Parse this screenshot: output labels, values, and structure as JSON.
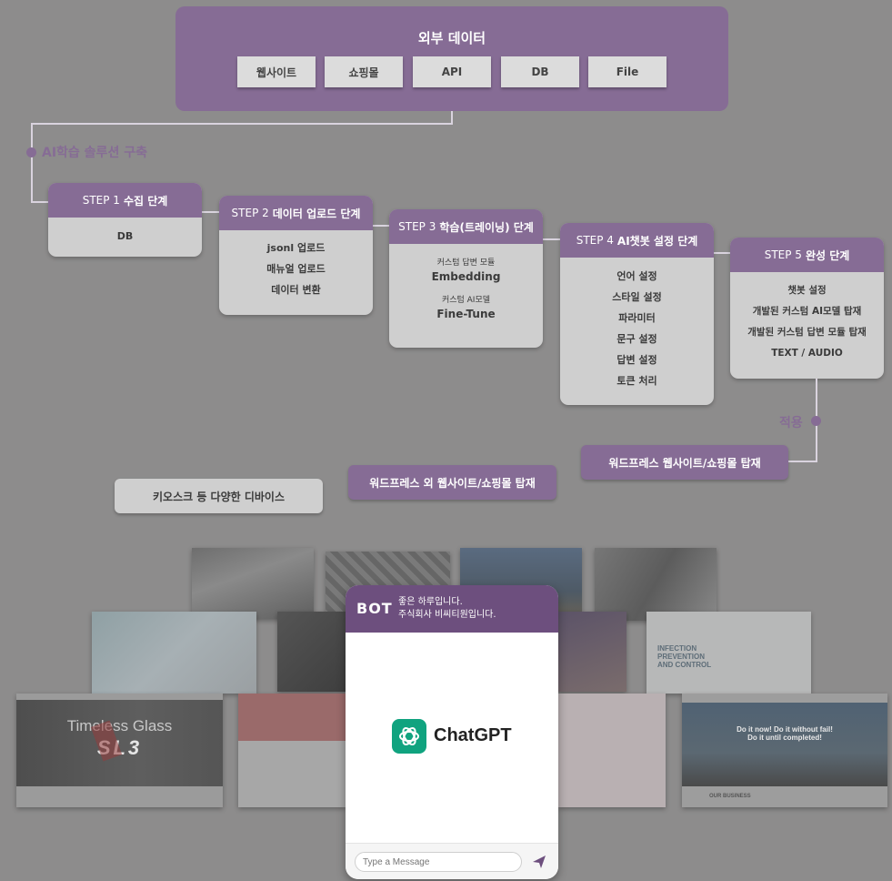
{
  "external": {
    "title": "외부 데이터",
    "sources": [
      "웹사이트",
      "쇼핑몰",
      "API",
      "DB",
      "File"
    ]
  },
  "ai_label": "AI학습 솔루션 구축",
  "apply_label": "적용",
  "steps": [
    {
      "num": "STEP 1",
      "title": "수집 단계",
      "items": [
        "DB"
      ]
    },
    {
      "num": "STEP 2",
      "title": "데이터 업로드 단계",
      "items": [
        "jsonl 업로드",
        "매뉴얼 업로드",
        "데이터 변환"
      ]
    },
    {
      "num": "STEP 3",
      "title": "학습(트레이닝) 단계",
      "items": [
        {
          "sub": "커스텀 답변 모듈",
          "main": "Embedding"
        },
        {
          "sub": "커스텀 AI모델",
          "main": "Fine-Tune"
        }
      ]
    },
    {
      "num": "STEP 4",
      "title": "AI챗봇 설정 단계",
      "items": [
        "언어 설정",
        "스타일 설정",
        "파라미터",
        "문구 설정",
        "답변 설정",
        "토큰 처리"
      ]
    },
    {
      "num": "STEP 5",
      "title": "완성 단계",
      "items": [
        "챗봇 설정",
        "개발된 커스텀 AI모델 탑재",
        "개발된 커스텀 답변 모듈 탑재",
        "TEXT / AUDIO"
      ]
    }
  ],
  "deploy": [
    "워드프레스 웹사이트/쇼핑몰 탑재",
    "워드프레스 외 웹사이트/쇼핑몰 탑재",
    "키오스크 등 다양한 디바이스"
  ],
  "chat": {
    "logo": "BOT",
    "greeting_line1": "좋은 하루입니다.",
    "greeting_line2": "주식회사 비씨티원입니다.",
    "product": "ChatGPT",
    "input_placeholder": "Type a Message"
  },
  "thumbnails": {
    "sl3_line1": "Timeless Glass",
    "sl3_logo": "SL3",
    "infection_text": "INFECTION PREVENTION AND CONTROL",
    "business_slogan": "Do it now! Do it without fail! Do it until completed!",
    "business_section": "OUR BUSINESS"
  },
  "colors": {
    "accent": "#866c95",
    "card": "#cfcfcf",
    "background": "#8d8c8c",
    "chat_header": "#6d4f7e",
    "gpt_green": "#10a37f"
  }
}
